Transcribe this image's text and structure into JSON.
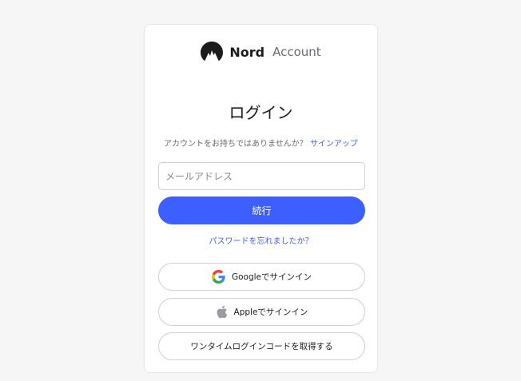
{
  "logo": {
    "brand": "Nord",
    "product": "Account"
  },
  "title": "ログイン",
  "signup": {
    "prompt": "アカウントをお持ちではありませんか？",
    "link": "サインアップ"
  },
  "email": {
    "placeholder": "メールアドレス",
    "value": ""
  },
  "continue_label": "続行",
  "forgot_label": "パスワードを忘れましたか？",
  "alt_signin": {
    "google_label": "Googleでサインイン",
    "apple_label": "Appleでサインイン",
    "otp_label": "ワンタイムログインコードを取得する"
  },
  "colors": {
    "accent": "#3e5fff",
    "background": "#f6f6f7",
    "card": "#ffffff",
    "text": "#1c1c1e",
    "muted": "#6a6a70"
  },
  "icons": [
    "nord-logo-icon",
    "google-icon",
    "apple-icon"
  ]
}
